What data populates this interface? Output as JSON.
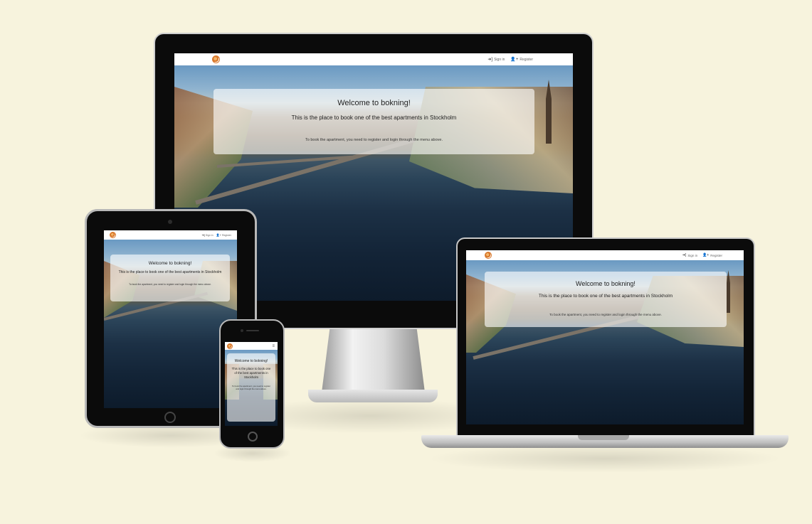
{
  "site": {
    "nav": {
      "sign_in": "Sign in",
      "register": "Register"
    },
    "hero": {
      "title": "Welcome to bokning!",
      "subtitle": "This is the place to book one of the best apartments in Stockholm",
      "instruction": "To book the apartment, you need to register and login through the menu above."
    },
    "mobile_menu_icon": "hamburger-icon"
  },
  "colors": {
    "background": "#f7f3dd",
    "logo_accent": "#d9782c",
    "panel": "rgba(255,255,255,0.62)"
  },
  "icons": {
    "sign_in": "sign-in-icon",
    "register": "user-plus-icon"
  }
}
